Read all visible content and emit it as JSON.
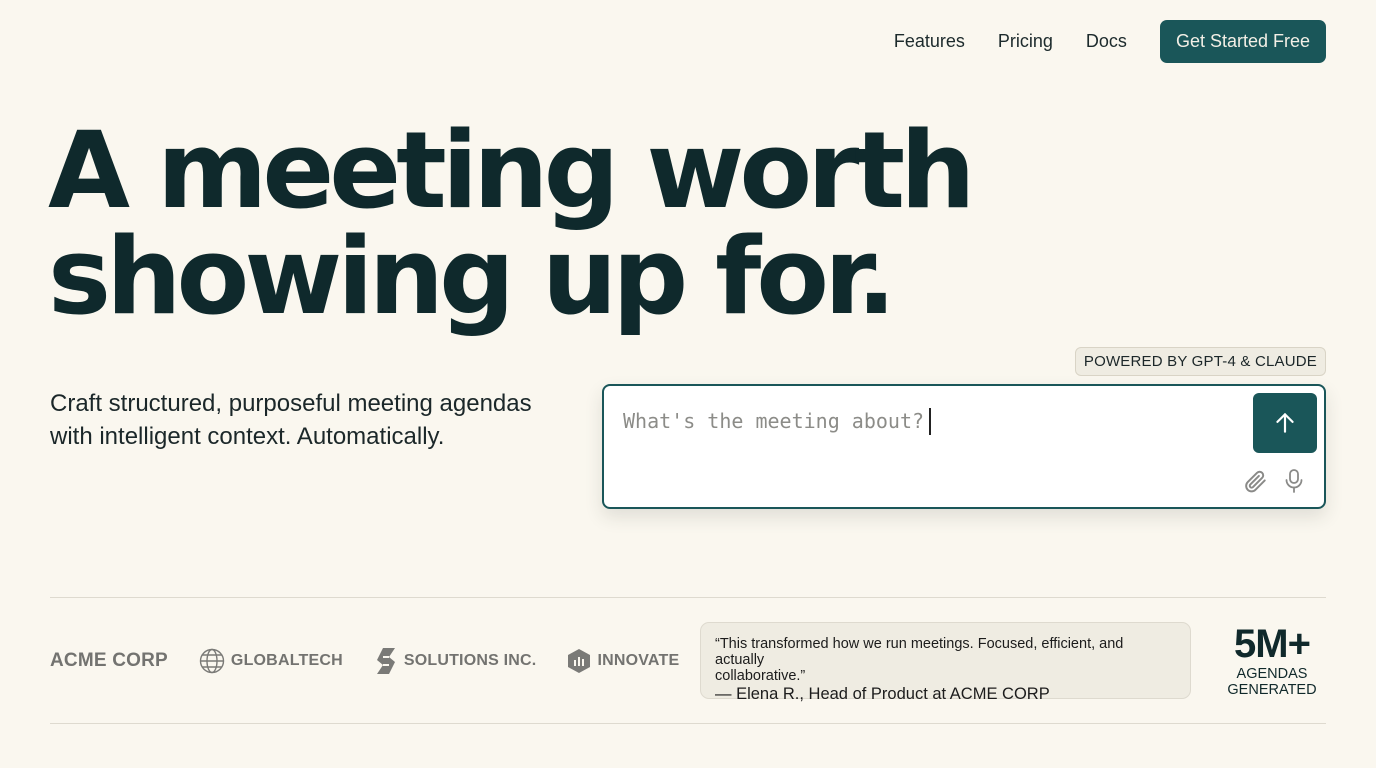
{
  "nav": {
    "links": [
      "Features",
      "Pricing",
      "Docs"
    ],
    "cta_label": "Get Started Free"
  },
  "hero": {
    "title_line1": "A meeting worth",
    "title_line2": "showing up for.",
    "subtitle_line1": "Craft structured, purposeful meeting agendas",
    "subtitle_line2": "with intelligent context. Automatically."
  },
  "prompt": {
    "badge": "POWERED BY GPT-4 & CLAUDE",
    "placeholder": "What's the meeting about?",
    "send_icon": "arrow-up-icon",
    "attach_icon": "paperclip-icon",
    "mic_icon": "microphone-icon"
  },
  "logos": [
    {
      "name": "ACME CORP",
      "icon": "none"
    },
    {
      "name": "GLOBALTECH",
      "icon": "globe-icon"
    },
    {
      "name": "SOLUTIONS INC.",
      "icon": "s-mark-icon"
    },
    {
      "name": "INNOVATE",
      "icon": "hexagon-chart-icon"
    }
  ],
  "testimonial": {
    "quote_line1": "“This transformed how we run meetings. Focused, efficient, and actually",
    "quote_line2": "collaborative.”",
    "author": "— Elena R., Head of Product at ACME CORP"
  },
  "stat": {
    "value": "5M+",
    "label_line1": "AGENDAS",
    "label_line2": "GENERATED"
  },
  "colors": {
    "background": "#faf7ef",
    "accent": "#1a5659",
    "heading": "#0f292c",
    "muted_logo": "#737370"
  }
}
